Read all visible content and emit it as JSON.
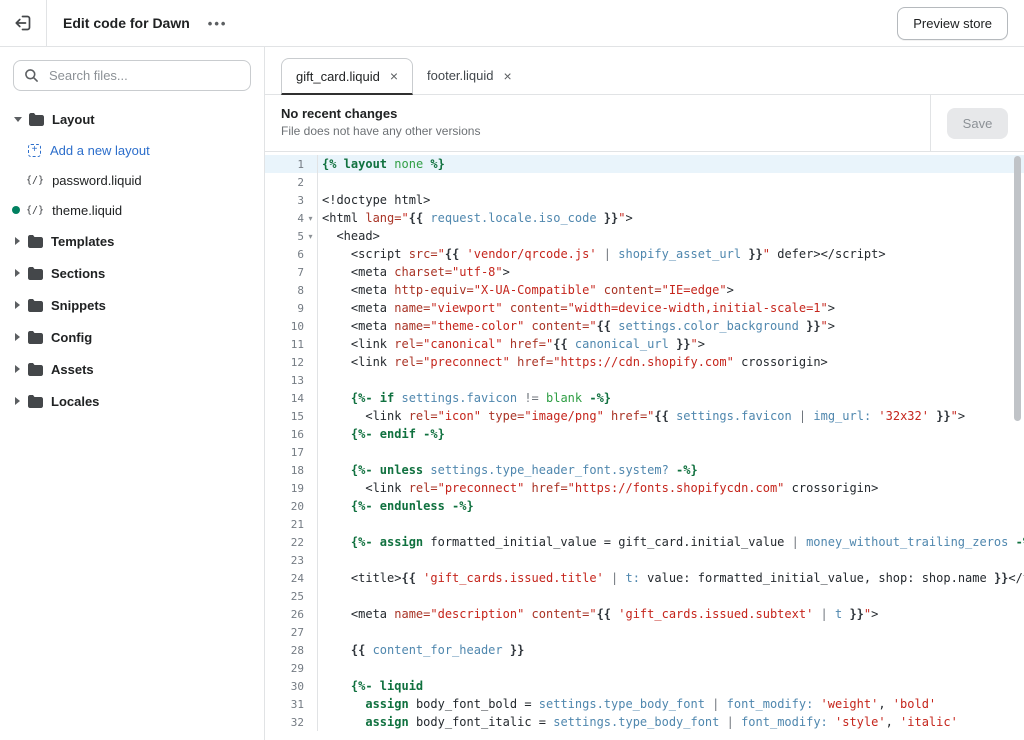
{
  "topbar": {
    "title": "Edit code for Dawn",
    "preview_label": "Preview store"
  },
  "icons": {
    "overflow_menu": "•••",
    "tab_close": "×",
    "fold_chevron": "▾",
    "liquid_file": "{/}"
  },
  "colors": {
    "accent_link_blue": "#2c6ecb",
    "open_file_dot_green": "#008060",
    "keyword_green": "#10713f",
    "string_red": "#c5251c",
    "variable_blue": "#4f87ae",
    "active_line_blue": "#e9f4fb"
  },
  "sidebar": {
    "search_placeholder": "Search files...",
    "tree": [
      {
        "label": "Layout",
        "type": "folder-expanded"
      },
      {
        "label": "Add a new layout",
        "type": "add-action"
      },
      {
        "label": "password.liquid",
        "type": "file"
      },
      {
        "label": "theme.liquid",
        "type": "file-open"
      },
      {
        "label": "Templates",
        "type": "folder"
      },
      {
        "label": "Sections",
        "type": "folder"
      },
      {
        "label": "Snippets",
        "type": "folder"
      },
      {
        "label": "Config",
        "type": "folder"
      },
      {
        "label": "Assets",
        "type": "folder"
      },
      {
        "label": "Locales",
        "type": "folder"
      }
    ]
  },
  "tabs": [
    {
      "label": "gift_card.liquid",
      "active": true
    },
    {
      "label": "footer.liquid",
      "active": false
    }
  ],
  "version_bar": {
    "title": "No recent changes",
    "subtitle": "File does not have any other versions",
    "save_label": "Save"
  },
  "editor": {
    "active_line": 1,
    "fold_lines": [
      4,
      5
    ],
    "lines": [
      [
        [
          "kw",
          "{% layout"
        ],
        [
          "p",
          " "
        ],
        [
          "atom",
          "none"
        ],
        [
          "kw",
          " %}"
        ]
      ],
      [],
      [
        [
          "p",
          "<!doctype html>"
        ]
      ],
      [
        [
          "p",
          "<html "
        ],
        [
          "attr",
          "lang="
        ],
        [
          "str",
          "\""
        ],
        [
          "delim",
          "{{"
        ],
        [
          "var",
          " request.locale.iso_code "
        ],
        [
          "delim",
          "}}"
        ],
        [
          "str",
          "\""
        ],
        [
          "p",
          ">"
        ]
      ],
      [
        [
          "p",
          "  <head>"
        ]
      ],
      [
        [
          "p",
          "    <script "
        ],
        [
          "attr",
          "src="
        ],
        [
          "str",
          "\""
        ],
        [
          "delim",
          "{{"
        ],
        [
          "str",
          " 'vendor/qrcode.js' "
        ],
        [
          "op",
          "|"
        ],
        [
          "var",
          " shopify_asset_url "
        ],
        [
          "delim",
          "}}"
        ],
        [
          "str",
          "\""
        ],
        [
          "p",
          " defer></script>"
        ]
      ],
      [
        [
          "p",
          "    <meta "
        ],
        [
          "attr",
          "charset="
        ],
        [
          "str",
          "\"utf-8\""
        ],
        [
          "p",
          ">"
        ]
      ],
      [
        [
          "p",
          "    <meta "
        ],
        [
          "attr",
          "http-equiv="
        ],
        [
          "str",
          "\"X-UA-Compatible\""
        ],
        [
          "p",
          " "
        ],
        [
          "attr",
          "content="
        ],
        [
          "str",
          "\"IE=edge\""
        ],
        [
          "p",
          ">"
        ]
      ],
      [
        [
          "p",
          "    <meta "
        ],
        [
          "attr",
          "name="
        ],
        [
          "str",
          "\"viewport\""
        ],
        [
          "p",
          " "
        ],
        [
          "attr",
          "content="
        ],
        [
          "str",
          "\"width=device-width,initial-scale=1\""
        ],
        [
          "p",
          ">"
        ]
      ],
      [
        [
          "p",
          "    <meta "
        ],
        [
          "attr",
          "name="
        ],
        [
          "str",
          "\"theme-color\""
        ],
        [
          "p",
          " "
        ],
        [
          "attr",
          "content="
        ],
        [
          "str",
          "\""
        ],
        [
          "delim",
          "{{"
        ],
        [
          "var",
          " settings.color_background "
        ],
        [
          "delim",
          "}}"
        ],
        [
          "str",
          "\""
        ],
        [
          "p",
          ">"
        ]
      ],
      [
        [
          "p",
          "    <link "
        ],
        [
          "attr",
          "rel="
        ],
        [
          "str",
          "\"canonical\""
        ],
        [
          "p",
          " "
        ],
        [
          "attr",
          "href="
        ],
        [
          "str",
          "\""
        ],
        [
          "delim",
          "{{"
        ],
        [
          "var",
          " canonical_url "
        ],
        [
          "delim",
          "}}"
        ],
        [
          "str",
          "\""
        ],
        [
          "p",
          ">"
        ]
      ],
      [
        [
          "p",
          "    <link "
        ],
        [
          "attr",
          "rel="
        ],
        [
          "str",
          "\"preconnect\""
        ],
        [
          "p",
          " "
        ],
        [
          "attr",
          "href="
        ],
        [
          "str",
          "\"https://cdn.shopify.com\""
        ],
        [
          "p",
          " crossorigin>"
        ]
      ],
      [],
      [
        [
          "p",
          "    "
        ],
        [
          "kw",
          "{%- if"
        ],
        [
          "var",
          " settings.favicon "
        ],
        [
          "op",
          "!= "
        ],
        [
          "atom",
          "blank"
        ],
        [
          "kw",
          " -%}"
        ]
      ],
      [
        [
          "p",
          "      <link "
        ],
        [
          "attr",
          "rel="
        ],
        [
          "str",
          "\"icon\""
        ],
        [
          "p",
          " "
        ],
        [
          "attr",
          "type="
        ],
        [
          "str",
          "\"image/png\""
        ],
        [
          "p",
          " "
        ],
        [
          "attr",
          "href="
        ],
        [
          "str",
          "\""
        ],
        [
          "delim",
          "{{"
        ],
        [
          "var",
          " settings.favicon "
        ],
        [
          "op",
          "|"
        ],
        [
          "var",
          " img_url:"
        ],
        [
          "str",
          " '32x32' "
        ],
        [
          "delim",
          "}}"
        ],
        [
          "str",
          "\""
        ],
        [
          "p",
          ">"
        ]
      ],
      [
        [
          "p",
          "    "
        ],
        [
          "kw",
          "{%- endif -%}"
        ]
      ],
      [],
      [
        [
          "p",
          "    "
        ],
        [
          "kw",
          "{%- unless"
        ],
        [
          "var",
          " settings.type_header_font.system?"
        ],
        [
          "kw",
          " -%}"
        ]
      ],
      [
        [
          "p",
          "      <link "
        ],
        [
          "attr",
          "rel="
        ],
        [
          "str",
          "\"preconnect\""
        ],
        [
          "p",
          " "
        ],
        [
          "attr",
          "href="
        ],
        [
          "str",
          "\"https://fonts.shopifycdn.com\""
        ],
        [
          "p",
          " crossorigin>"
        ]
      ],
      [
        [
          "p",
          "    "
        ],
        [
          "kw",
          "{%- endunless -%}"
        ]
      ],
      [],
      [
        [
          "p",
          "    "
        ],
        [
          "kw",
          "{%- assign"
        ],
        [
          "p",
          " formatted_initial_value = gift_card.initial_value "
        ],
        [
          "op",
          "|"
        ],
        [
          "var",
          " money_without_trailing_zeros "
        ],
        [
          "kw",
          "-%}"
        ]
      ],
      [],
      [
        [
          "p",
          "    <title>"
        ],
        [
          "delim",
          "{{"
        ],
        [
          "str",
          " 'gift_cards.issued.title' "
        ],
        [
          "op",
          "|"
        ],
        [
          "var",
          " t:"
        ],
        [
          "p",
          " value: formatted_initial_value, shop: shop.name "
        ],
        [
          "delim",
          "}}"
        ],
        [
          "p",
          "</title>"
        ]
      ],
      [],
      [
        [
          "p",
          "    <meta "
        ],
        [
          "attr",
          "name="
        ],
        [
          "str",
          "\"description\""
        ],
        [
          "p",
          " "
        ],
        [
          "attr",
          "content="
        ],
        [
          "str",
          "\""
        ],
        [
          "delim",
          "{{"
        ],
        [
          "str",
          " 'gift_cards.issued.subtext' "
        ],
        [
          "op",
          "|"
        ],
        [
          "var",
          " t "
        ],
        [
          "delim",
          "}}"
        ],
        [
          "str",
          "\""
        ],
        [
          "p",
          ">"
        ]
      ],
      [],
      [
        [
          "p",
          "    "
        ],
        [
          "delim",
          "{{"
        ],
        [
          "var",
          " content_for_header "
        ],
        [
          "delim",
          "}}"
        ]
      ],
      [],
      [
        [
          "p",
          "    "
        ],
        [
          "kw",
          "{%- liquid"
        ]
      ],
      [
        [
          "p",
          "      "
        ],
        [
          "kw",
          "assign"
        ],
        [
          "p",
          " body_font_bold = "
        ],
        [
          "var",
          "settings.type_body_font "
        ],
        [
          "op",
          "|"
        ],
        [
          "var",
          " font_modify:"
        ],
        [
          "str",
          " 'weight'"
        ],
        [
          "p",
          ","
        ],
        [
          "str",
          " 'bold'"
        ]
      ],
      [
        [
          "p",
          "      "
        ],
        [
          "kw",
          "assign"
        ],
        [
          "p",
          " body_font_italic = "
        ],
        [
          "var",
          "settings.type_body_font "
        ],
        [
          "op",
          "|"
        ],
        [
          "var",
          " font_modify:"
        ],
        [
          "str",
          " 'style'"
        ],
        [
          "p",
          ","
        ],
        [
          "str",
          " 'italic'"
        ]
      ]
    ]
  }
}
